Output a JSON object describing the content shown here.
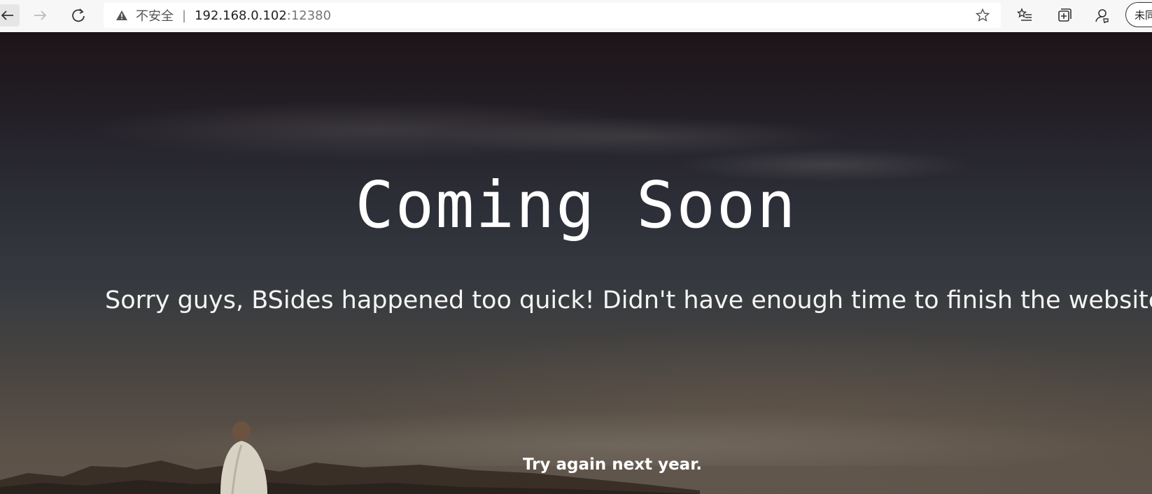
{
  "browser": {
    "address": {
      "security_label": "不安全",
      "separator": "|",
      "host": "192.168.0.102",
      "port": ":12380"
    },
    "profile_label": "未同步",
    "icons": {
      "back": "back-arrow-icon",
      "forward": "forward-arrow-icon",
      "refresh": "refresh-icon",
      "warning": "warning-icon",
      "favorite": "star-icon",
      "favorites_list": "favorites-icon",
      "collections": "collections-icon",
      "feedback": "feedback-icon"
    }
  },
  "page": {
    "heading": "Coming Soon",
    "message": "Sorry guys, BSides happened too quick! Didn't have enough time to finish the website.",
    "footnote": "Try again next year."
  }
}
